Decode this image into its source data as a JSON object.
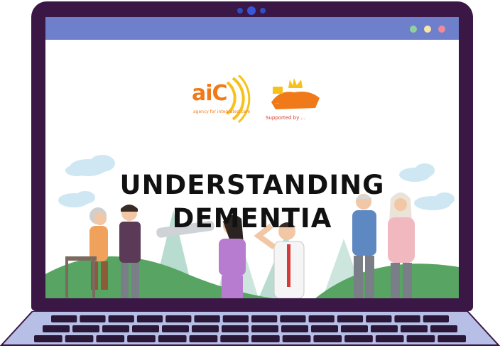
{
  "window": {
    "controls": [
      {
        "name": "minimize",
        "color": "#8fd19e"
      },
      {
        "name": "maximize",
        "color": "#f6e6a8"
      },
      {
        "name": "close",
        "color": "#f08a97"
      }
    ]
  },
  "slide": {
    "title_line1": "UNDERSTANDING",
    "title_line2": "DEMENTIA",
    "logo_left": {
      "text": "aiC",
      "subtext": "agency for integrated care"
    },
    "logo_right": {
      "caption": "Supported by ...",
      "badge_text": "..."
    }
  },
  "colors": {
    "laptop_frame": "#3b1746",
    "titlebar": "#6e80cc",
    "keyboard_base": "#b7bfe6",
    "keys": "#2b1738",
    "hills": "#57a463",
    "leaves": "#b9dcd0"
  },
  "icons": [
    "webcam-icon",
    "aic-logo",
    "singapore-logo",
    "cloud-icon"
  ]
}
